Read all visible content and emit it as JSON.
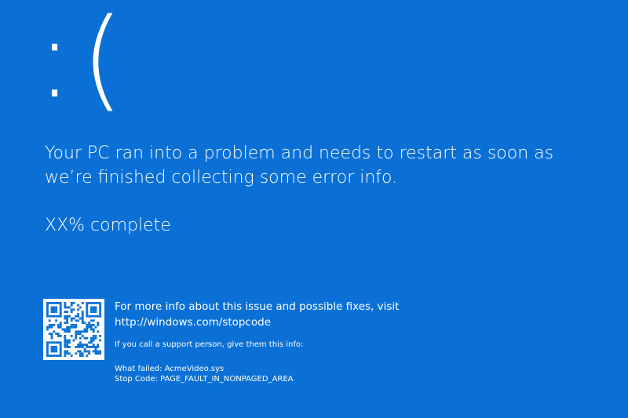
{
  "colors": {
    "background": "#0A70D6",
    "foreground": "#FFFFFF"
  },
  "face": {
    "emoticon": ":("
  },
  "message": {
    "line1": "Your PC ran into a problem and needs to restart as soon as",
    "line2": "we’re finished collecting some error info."
  },
  "progress": {
    "text": "XX% complete"
  },
  "qr": {
    "icon": "qr-code-icon"
  },
  "more_info": {
    "line1": "For more info about this issue and possible fixes, visit",
    "url": "http://windows.com/stopcode"
  },
  "support": {
    "text": "If you call a support person, give them this info:"
  },
  "details": {
    "what_failed": "What failed: AcmeVideo.sys",
    "stop_code": "Stop Code: PAGE_FAULT_IN_NONPAGED_AREA"
  }
}
